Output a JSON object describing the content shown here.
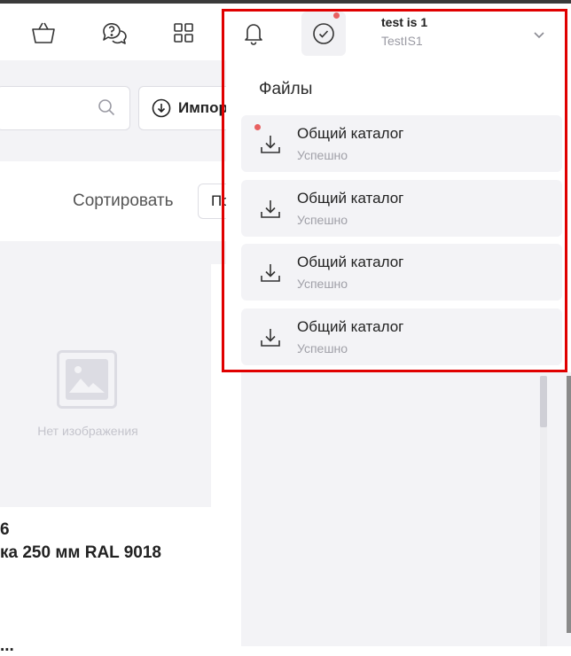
{
  "header": {
    "user_name": "test is 1",
    "user_org": "TestIS1"
  },
  "toolbar": {
    "import_label": "Импорт",
    "sort_label": "Сортировать",
    "sort_value": "По"
  },
  "product": {
    "no_image_text": "Нет изображения",
    "code_fragment": "6",
    "name_fragment": "ка 250 мм RAL 9018",
    "price_fragment": "..."
  },
  "files_panel": {
    "title": "Файлы",
    "items": [
      {
        "name": "Общий каталог",
        "status": "Успешно",
        "unread": true
      },
      {
        "name": "Общий каталог",
        "status": "Успешно",
        "unread": false
      },
      {
        "name": "Общий каталог",
        "status": "Успешно",
        "unread": false
      },
      {
        "name": "Общий каталог",
        "status": "Успешно",
        "unread": false
      }
    ]
  },
  "icons": {
    "cart": "basket-icon",
    "support": "chat-question-icon",
    "apps": "grid-icon",
    "notifications": "bell-icon",
    "tasks": "check-circle-icon",
    "download": "download-icon",
    "user_menu": "chevron-down-icon"
  },
  "colors": {
    "badge": "#e86060",
    "highlight": "#e00000",
    "panel_bg": "#f3f3f6",
    "muted_text": "#a0a0a8"
  }
}
